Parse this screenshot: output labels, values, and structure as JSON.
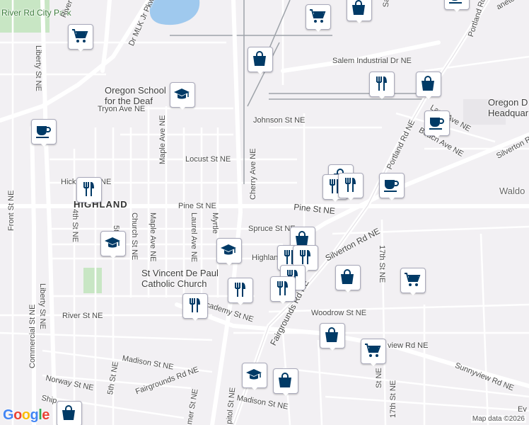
{
  "map": {
    "logo": "Google",
    "attribution": "Map data ©2026",
    "colors": {
      "background": "#f2f0f3",
      "road": "#ffffff",
      "water": "#9fc9ee",
      "park": "#c8e6c4",
      "rail": "#9ea3a9",
      "pin": "#003a66"
    }
  },
  "labels": {
    "river_rd_city_park": "River Rd\nCity Park",
    "dr_mlk_jr_pkwy": "Dr MLK Jr Pkwy",
    "river_st_top": "River St",
    "liberty_st_top": "Liberty St NE",
    "salem_industrial_dr": "Salem Industrial Dr NE",
    "salem_industrial_short": "Salem Industrial Dr NE",
    "portland_rd_top": "Portland Rd",
    "oregon_school": "Oregon School\nfor the Deaf",
    "tryon_ave": "Tryon Ave NE",
    "oregon_dept": "Oregon D\nHeadquar",
    "front_st": "Front St NE",
    "liberty_st": "Liberty St NE",
    "commercial_st": "Commercial St NE",
    "maple_ave_top": "Maple Ave NE",
    "johnson_st": "Johnson St NE",
    "lana_ave": "Lana Ave NE",
    "beach_ave": "Beach Ave NE",
    "portland_rd_ne": "Portland Rd NE",
    "silverton_rd_top": "Silverton R",
    "locust_st": "Locust St NE",
    "cherry_ave": "Cherry Ave NE",
    "hickory": "Hick",
    "hickory_ne": "NE",
    "waldo": "Waldo",
    "highland": "HIGHLAND",
    "pine_st_left": "Pine St NE",
    "pine_st_right": "Pine St NE",
    "fourth_st": "4th St NE",
    "spruce_st": "Spruce St NE",
    "silverton_rd_ne": "Silverton Rd NE",
    "fifth_st": "5th St",
    "church_st": "Church St NE",
    "maple_ave": "Maple Ave NE",
    "laurel_ave": "Laurel Ave NE",
    "myrtle": "Myrtle",
    "highland_ave": "Highlan",
    "seventeenth_st": "17th St NE",
    "st_vincent": "St Vincent De Paul\nCatholic Church",
    "academy_st": "Academy St NE",
    "fairgrounds_rd": "Fairgrounds Rd NE",
    "woodrow_st": "Woodrow St NE",
    "river_st": "River St NE",
    "sunnyview_rd": "view Rd NE",
    "sunnyview_rd2": "Sunnyview Rd NE",
    "seventeenth_st_b": "17th St NE",
    "st_ne": "St NE",
    "madison_st": "Madison St NE",
    "madison_st2": "Madison St NE",
    "norway_st": "Norway St NE",
    "fifth_st_b": "5th St NE",
    "capitol_st": "pitol St NE",
    "ship": "Ship",
    "fairgrounds_rd2": "Fairgrounds Rd NE",
    "summer_st": "mer St NE",
    "eve": "Ev",
    "ane_ave": "aneton"
  },
  "pins": [
    {
      "id": "shopping-cart-1",
      "icon": "cart"
    },
    {
      "id": "bag-1",
      "icon": "bag"
    },
    {
      "id": "cart-2",
      "icon": "cart"
    },
    {
      "id": "bag-2",
      "icon": "bag"
    },
    {
      "id": "restaurant-1",
      "icon": "fork"
    },
    {
      "id": "bag-3",
      "icon": "bag"
    },
    {
      "id": "school-1",
      "icon": "school"
    },
    {
      "id": "cafe-1",
      "icon": "cup"
    },
    {
      "id": "cafe-2",
      "icon": "cup"
    },
    {
      "id": "restaurant-2",
      "icon": "fork"
    },
    {
      "id": "bag-4",
      "icon": "bag"
    },
    {
      "id": "restaurant-3",
      "icon": "fork"
    },
    {
      "id": "restaurant-4",
      "icon": "fork"
    },
    {
      "id": "cafe-3",
      "icon": "cup"
    },
    {
      "id": "school-2",
      "icon": "school"
    },
    {
      "id": "bag-5",
      "icon": "bag"
    },
    {
      "id": "school-3",
      "icon": "school"
    },
    {
      "id": "restaurant-5",
      "icon": "fork"
    },
    {
      "id": "restaurant-6",
      "icon": "fork"
    },
    {
      "id": "restaurant-7",
      "icon": "fork"
    },
    {
      "id": "restaurant-8",
      "icon": "fork"
    },
    {
      "id": "cart-3",
      "icon": "cart"
    },
    {
      "id": "restaurant-9",
      "icon": "fork"
    },
    {
      "id": "bag-6",
      "icon": "bag"
    },
    {
      "id": "restaurant-10",
      "icon": "fork"
    },
    {
      "id": "bag-7",
      "icon": "bag"
    },
    {
      "id": "cart-4",
      "icon": "cart"
    },
    {
      "id": "school-4",
      "icon": "school"
    },
    {
      "id": "bag-8",
      "icon": "bag"
    },
    {
      "id": "bag-9",
      "icon": "bag"
    },
    {
      "id": "cafe-4",
      "icon": "cup"
    }
  ]
}
